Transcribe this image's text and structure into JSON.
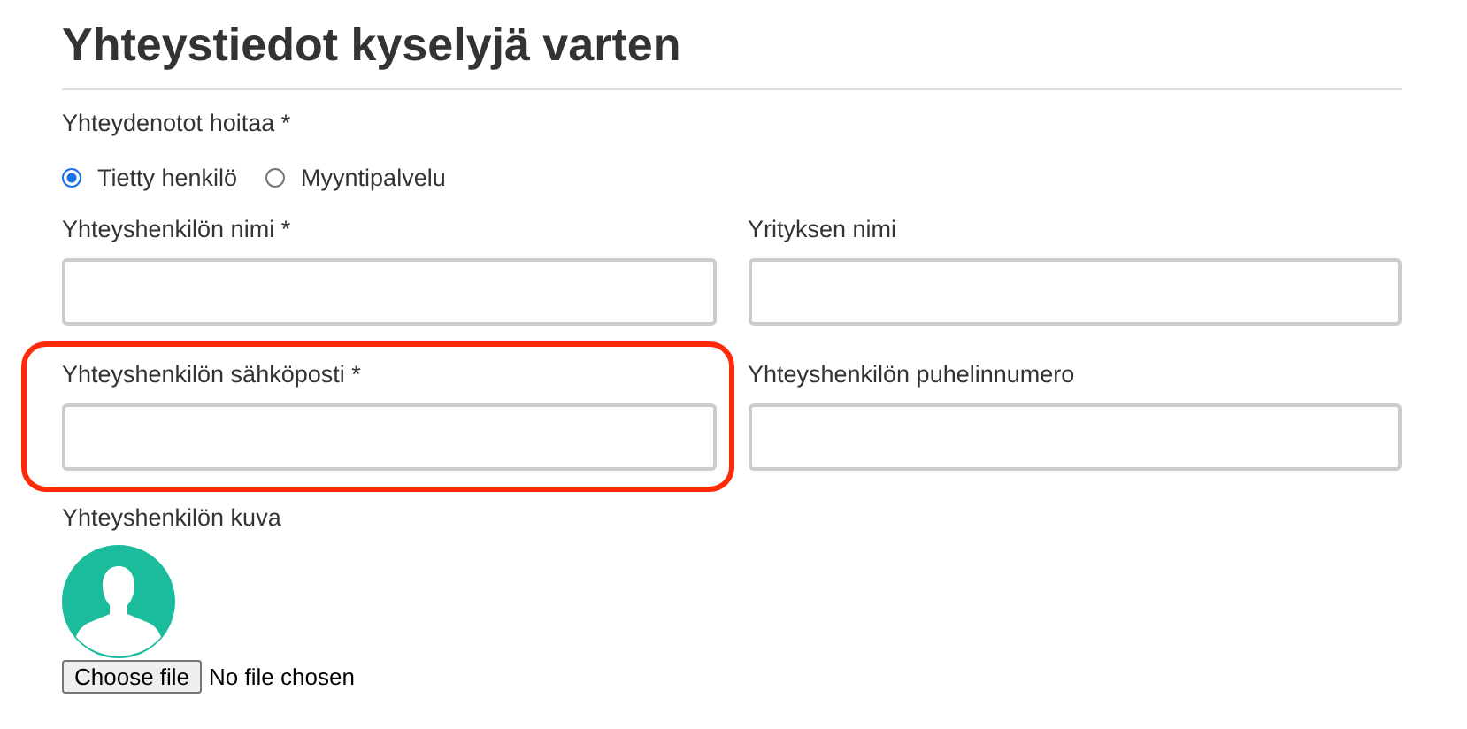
{
  "title": "Yhteystiedot kyselyjä varten",
  "contact_handler": {
    "label": "Yhteydenotot hoitaa *",
    "options": [
      {
        "label": "Tietty henkilö",
        "selected": true
      },
      {
        "label": "Myyntipalvelu",
        "selected": false
      }
    ]
  },
  "fields": [
    {
      "label": "Yhteyshenkilön nimi *",
      "highlighted": false
    },
    {
      "label": "Yrityksen nimi",
      "highlighted": false
    },
    {
      "label": "Yhteyshenkilön sähköposti *",
      "highlighted": true
    },
    {
      "label": "Yhteyshenkilön puhelinnumero",
      "highlighted": false
    }
  ],
  "photo": {
    "label": "Yhteyshenkilön kuva",
    "button": "Choose file",
    "status": "No file chosen"
  }
}
